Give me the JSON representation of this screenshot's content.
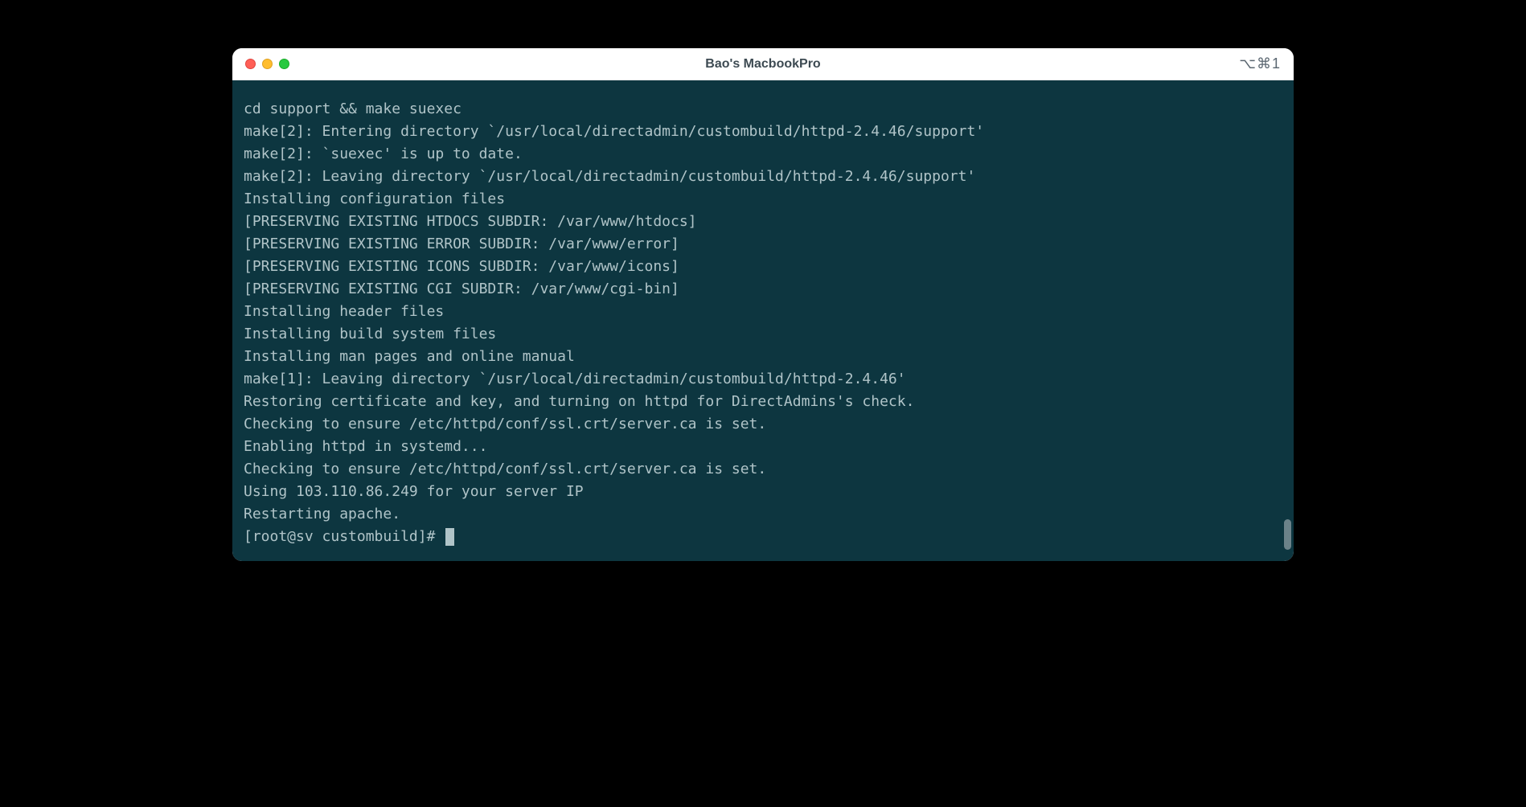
{
  "window": {
    "title": "Bao's MacbookPro",
    "shortcut_hint": "⌥⌘1"
  },
  "terminal": {
    "lines": [
      "cd support && make suexec",
      "make[2]: Entering directory `/usr/local/directadmin/custombuild/httpd-2.4.46/support'",
      "make[2]: `suexec' is up to date.",
      "make[2]: Leaving directory `/usr/local/directadmin/custombuild/httpd-2.4.46/support'",
      "Installing configuration files",
      "[PRESERVING EXISTING HTDOCS SUBDIR: /var/www/htdocs]",
      "[PRESERVING EXISTING ERROR SUBDIR: /var/www/error]",
      "[PRESERVING EXISTING ICONS SUBDIR: /var/www/icons]",
      "[PRESERVING EXISTING CGI SUBDIR: /var/www/cgi-bin]",
      "Installing header files",
      "Installing build system files",
      "Installing man pages and online manual",
      "make[1]: Leaving directory `/usr/local/directadmin/custombuild/httpd-2.4.46'",
      "Restoring certificate and key, and turning on httpd for DirectAdmins's check.",
      "Checking to ensure /etc/httpd/conf/ssl.crt/server.ca is set.",
      "Enabling httpd in systemd...",
      "Checking to ensure /etc/httpd/conf/ssl.crt/server.ca is set.",
      "Using 103.110.86.249 for your server IP",
      "Restarting apache."
    ],
    "prompt": "[root@sv custombuild]# "
  }
}
